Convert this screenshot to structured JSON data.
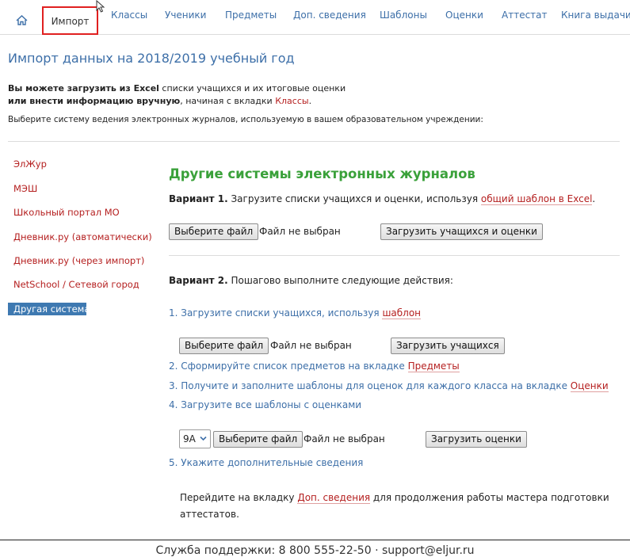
{
  "nav": {
    "items": [
      "Импорт",
      "Классы",
      "Ученики",
      "Предметы",
      "Доп. сведения",
      "Шаблоны",
      "Оценки",
      "Аттестат",
      "Книга выдачи"
    ]
  },
  "header": {
    "title": "Импорт данных на 2018/2019 учебный год",
    "intro_line1_bold": "Вы можете загрузить из Excel",
    "intro_line1_rest": " списки учащихся и их итоговые оценки",
    "intro_line2_bold": "или внести информацию вручную",
    "intro_line2_rest": ", начиная с вкладки ",
    "intro_link": "Классы",
    "intro_end": ".",
    "select_system": "Выберите систему ведения электронных журналов, используемую в вашем образовательном учреждении:"
  },
  "sidebar": {
    "items": [
      "ЭлЖур",
      "МЭШ",
      "Школьный портал МО",
      "Дневник.ру (автоматически)",
      "Дневник.ру (через импорт)",
      "NetSchool / Сетевой город"
    ],
    "active": "Другая система"
  },
  "main": {
    "title": "Другие системы электронных журналов",
    "v1_label": "Вариант 1.",
    "v1_text": " Загрузите списки учащихся и оценки, используя ",
    "v1_link": "общий шаблон в Excel",
    "v1_end": ".",
    "choose_file": "Выберите файл",
    "no_file": "Файл не выбран",
    "upload_students_grades": "Загрузить учащихся и оценки",
    "v2_label": "Вариант 2.",
    "v2_text": " Пошагово выполните следующие действия:",
    "step1_text": "1. Загрузите списки учащихся, используя ",
    "step1_link": "шаблон",
    "upload_students": "Загрузить учащихся",
    "step2_text": "2. Сформируйте список предметов на вкладке ",
    "step2_link": "Предметы",
    "step3_text": "3. Получите и заполните шаблоны для оценок для каждого класса на вкладке ",
    "step3_link": "Оценки",
    "step4_text": "4. Загрузите все шаблоны с оценками",
    "class_select": "9А",
    "upload_grades": "Загрузить оценки",
    "step5_text": "5. Укажите дополнительные сведения",
    "para_text1": "Перейдите на вкладку ",
    "para_link": "Доп. сведения",
    "para_text2": " для продолжения работы мастера подготовки аттестатов."
  },
  "footer": {
    "text": "Служба поддержки: 8 800 555-22-50 · support@eljur.ru"
  },
  "icons": {
    "home": "home-icon",
    "chevron": "chevron-down-icon",
    "cursor": "mouse-cursor-icon"
  },
  "colors": {
    "link_blue": "#3d6fa8",
    "link_red": "#b52020",
    "title_green": "#3aa13a",
    "active_bg": "#3e79b1",
    "highlight_red": "#e02020"
  }
}
